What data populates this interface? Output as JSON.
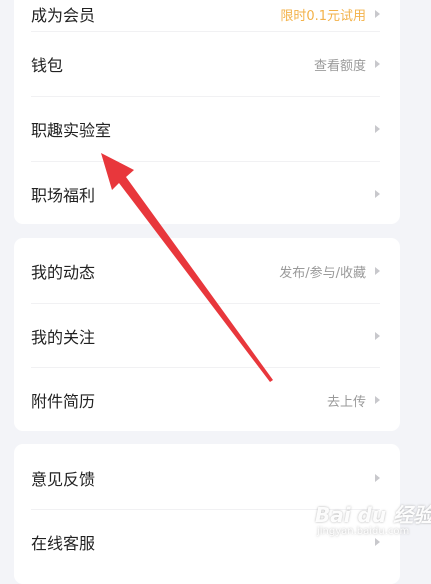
{
  "section1": {
    "rows": [
      {
        "label": "成为会员",
        "value": "限时0.1元试用"
      },
      {
        "label": "钱包",
        "value": "查看额度"
      },
      {
        "label": "职趣实验室",
        "value": ""
      },
      {
        "label": "职场福利",
        "value": ""
      }
    ]
  },
  "section2": {
    "rows": [
      {
        "label": "我的动态",
        "value": "发布/参与/收藏"
      },
      {
        "label": "我的关注",
        "value": ""
      },
      {
        "label": "附件简历",
        "value": "去上传"
      }
    ]
  },
  "section3": {
    "rows": [
      {
        "label": "意见反馈",
        "value": ""
      },
      {
        "label": "在线客服",
        "value": ""
      }
    ]
  },
  "watermark": {
    "logo": "Bai du 经验",
    "sub": "jingyan.baidu.com"
  },
  "colors": {
    "accent": "#f3b24a",
    "annotation_arrow": "#e8373c"
  },
  "icons": {
    "row_chevron": "chevron-right-icon",
    "annotation": "red-arrow-icon"
  }
}
